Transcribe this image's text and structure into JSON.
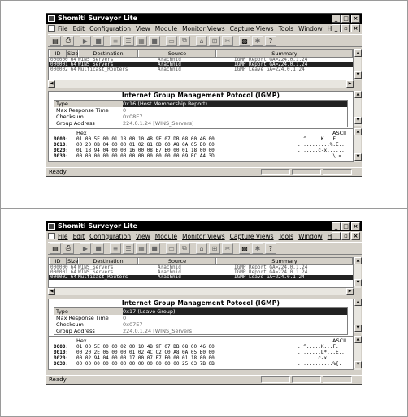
{
  "windows": [
    {
      "title": "Shomiti Surveyor Lite",
      "menu": [
        "File",
        "Edit",
        "Configuration",
        "View",
        "Module",
        "Monitor Views",
        "Capture Views",
        "Tools",
        "Window",
        "Help"
      ],
      "columns": [
        "ID",
        "Size",
        "Destination",
        "Source",
        "Summary"
      ],
      "packets": [
        {
          "id": "000000",
          "size": "64",
          "dest": "WINS_Servers",
          "src": "Arachnid",
          "summary": "IGMP Report  GA=224.0.1.24"
        },
        {
          "id": "000001",
          "size": "64",
          "dest": "WINS_Servers",
          "src": "Arachnid",
          "summary": "IGMP Report  GA=224.0.1.24"
        },
        {
          "id": "000002",
          "size": "64",
          "dest": "Multicast_Routers",
          "src": "Arachnid",
          "summary": "IGMP Leave  GA=224.0.1.24"
        }
      ],
      "decode_title": "Internet Group Management Potocol  (IGMP)",
      "fields": [
        {
          "name": "Type",
          "value": "0x16 (Host Membership Report)"
        },
        {
          "name": "Max Response Time",
          "value": "0"
        },
        {
          "name": "Checksum",
          "value": "0x08E7"
        },
        {
          "name": "Group Address",
          "value": "224.0.1.24 [WINS_Servers]"
        }
      ],
      "hex_label": "Hex",
      "ascii_label": "ASCII",
      "hex_rows": [
        {
          "offset": "0000:",
          "bytes": "01 00 5E 00 01 18 00 10 4B 9F 07 DB 08 00 46 00",
          "ascii": "..^.....K...F."
        },
        {
          "offset": "0010:",
          "bytes": "00 20 0B 04 00 00 01 02 81 0D C0 A8 0A 05 E0 00",
          "ascii": ". .........%.E.."
        },
        {
          "offset": "0020:",
          "bytes": "01 18 94 04 00 00 16 00 08 E7 E0 00 01 18 00 00",
          "ascii": ".......c-x......"
        },
        {
          "offset": "0030:",
          "bytes": "00 00 00 00 00 00 00 00 00 00 00 00 09 EC A4 3D",
          "ascii": "............\\.="
        }
      ],
      "status": "Ready"
    },
    {
      "title": "Shomiti Surveyor Lite",
      "menu": [
        "File",
        "Edit",
        "Configuration",
        "View",
        "Module",
        "Monitor Views",
        "Capture Views",
        "Tools",
        "Window",
        "Help"
      ],
      "columns": [
        "ID",
        "Size",
        "Destination",
        "Source",
        "Summary"
      ],
      "packets": [
        {
          "id": "000000",
          "size": "64",
          "dest": "WINS_Servers",
          "src": "Arachnid",
          "summary": "IGMP Report  GA=224.0.1.24"
        },
        {
          "id": "000001",
          "size": "64",
          "dest": "WINS_Servers",
          "src": "Arachnid",
          "summary": "IGMP Report  GA=224.0.1.24"
        },
        {
          "id": "000002",
          "size": "64",
          "dest": "Multicast_Routers",
          "src": "Arachnid",
          "summary": "IGMP Leave  GA=224.0.1.24"
        }
      ],
      "decode_title": "Internet Group Management Potocol  (IGMP)",
      "fields": [
        {
          "name": "Type",
          "value": "0x17 (Leave Group)"
        },
        {
          "name": "Max Response Time",
          "value": "0"
        },
        {
          "name": "Checksum",
          "value": "0x07E7"
        },
        {
          "name": "Group Address",
          "value": "224.0.1.24 [WINS_Servers]"
        }
      ],
      "hex_label": "Hex",
      "ascii_label": "ASCII",
      "hex_rows": [
        {
          "offset": "0000:",
          "bytes": "01 00 5E 00 00 02 00 10 4B 9F 07 DB 08 00 46 00",
          "ascii": "..^.....K...F."
        },
        {
          "offset": "0010:",
          "bytes": "00 20 2E 06 00 00 01 02 4C C2 C0 A8 0A 05 E0 00",
          "ascii": ". ......L*...E.."
        },
        {
          "offset": "0020:",
          "bytes": "00 02 94 04 00 00 17 00 07 E7 E0 00 01 18 00 00",
          "ascii": ".......c-x......"
        },
        {
          "offset": "0030:",
          "bytes": "00 00 00 00 00 00 00 00 00 00 00 00 25 C3 7B 0B",
          "ascii": "............%{."
        }
      ],
      "status": "Ready"
    }
  ],
  "config": {
    "selected_packet": [
      1,
      2
    ],
    "selected_field": 0,
    "toolbar_icons": [
      "open-icon",
      "print-icon",
      "play-icon",
      "stop-icon",
      "filter-icon",
      "capture-icon",
      "decode-icon",
      "stat-icon",
      "monitor-icon",
      "copy-icon",
      "paste-icon",
      "find-icon",
      "options-icon",
      "network-icon",
      "tool-icon",
      "help-icon"
    ]
  }
}
